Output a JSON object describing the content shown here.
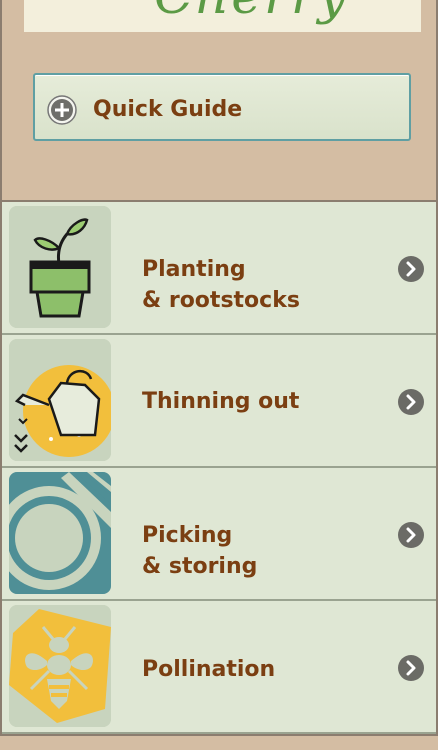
{
  "banner": {
    "title": "Cherry"
  },
  "quick_guide": {
    "label": "Quick Guide",
    "icon": "plus-circle-icon"
  },
  "menu": {
    "items": [
      {
        "line1": "Planting",
        "line2": "& rootstocks",
        "icon": "seedling-pot-icon"
      },
      {
        "line1": "Thinning out",
        "line2": "",
        "icon": "watering-can-icon"
      },
      {
        "line1": "Picking",
        "line2": "& storing",
        "icon": "plate-fork-icon"
      },
      {
        "line1": "Pollination",
        "line2": "",
        "icon": "bee-icon"
      }
    ]
  },
  "colors": {
    "label": "#7b3f12",
    "accent_teal": "#4f8f96",
    "accent_yellow": "#f2bf3c",
    "green": "#8dbf6a",
    "chevron": "#6b6b66"
  }
}
